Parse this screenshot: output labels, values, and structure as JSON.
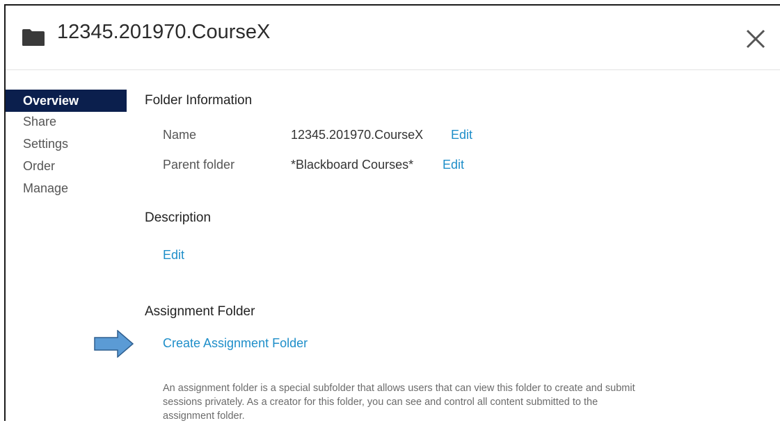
{
  "header": {
    "icon": "folder-icon",
    "title": "12345.201970.CourseX",
    "close_icon": "close-icon"
  },
  "sidebar": {
    "items": [
      {
        "label": "Overview",
        "active": true
      },
      {
        "label": "Share",
        "active": false
      },
      {
        "label": "Settings",
        "active": false
      },
      {
        "label": "Order",
        "active": false
      },
      {
        "label": "Manage",
        "active": false
      }
    ]
  },
  "folder_info": {
    "heading": "Folder Information",
    "name_label": "Name",
    "name_value": "12345.201970.CourseX",
    "name_edit": "Edit",
    "parent_label": "Parent folder",
    "parent_value": "*Blackboard Courses*",
    "parent_edit": "Edit"
  },
  "description": {
    "heading": "Description",
    "edit": "Edit"
  },
  "assignment": {
    "heading": "Assignment Folder",
    "create_link": "Create Assignment Folder",
    "help_text": "An assignment folder is a special subfolder that allows users that can view this folder to create and submit sessions privately. As a creator for this folder, you can see and control all content submitted to the assignment folder.",
    "pointer_icon": "arrow-right-icon"
  },
  "colors": {
    "nav_active_bg": "#0b1f4d",
    "link": "#1e8ec9",
    "arrow_fill": "#5b9bd5",
    "arrow_stroke": "#2f5f8f"
  }
}
